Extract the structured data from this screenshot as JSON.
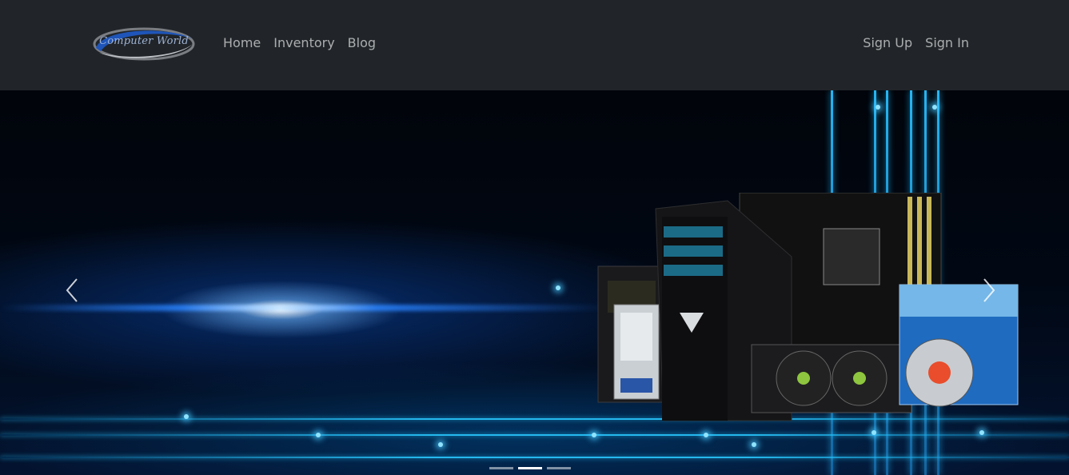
{
  "brand": {
    "name": "Computer World"
  },
  "nav": {
    "left": [
      {
        "label": "Home"
      },
      {
        "label": "Inventory"
      },
      {
        "label": "Blog"
      }
    ],
    "right": [
      {
        "label": "Sign Up"
      },
      {
        "label": "Sign In"
      }
    ]
  },
  "carousel": {
    "slide_count": 3,
    "active_index": 1,
    "image": "computer-hardware-banner",
    "controls": {
      "prev": "chevron-left-icon",
      "next": "chevron-right-icon"
    }
  },
  "colors": {
    "navbar_bg": "#212529",
    "nav_link": "#9a9da0",
    "accent_glow": "#28c8ff"
  }
}
